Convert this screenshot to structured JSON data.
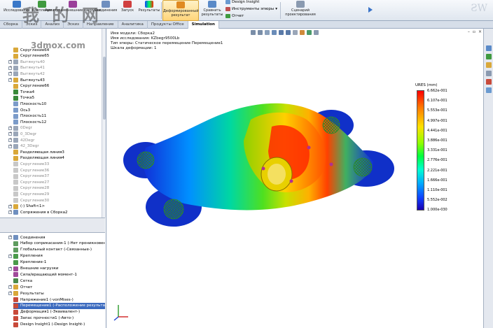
{
  "ribbon": {
    "research_label": "Исследование",
    "fixtures_label": "Крепления",
    "loads_label": "Арматура · Внешние нагрузки",
    "connections_label": "Соединения",
    "run_label": "Запуск",
    "results_label": "Результаты",
    "deformed_label": "Деформированный результат",
    "compare_label": "Сравнить результаты",
    "design_insight_label": "Design Insight",
    "plot_tools_label": "Инструменты эпюры",
    "report_label": "Отчет",
    "scenario_label": "Сценарий проектирования"
  },
  "tabs": [
    {
      "label": "Сборка"
    },
    {
      "label": "Эскиз"
    },
    {
      "label": "Анализ"
    },
    {
      "label": "Эскиз"
    },
    {
      "label": "Направление"
    },
    {
      "label": "Аналитика"
    },
    {
      "label": "Продукты Office"
    },
    {
      "label": "Simulation"
    }
  ],
  "tree_top": [
    {
      "label": "Скругление64",
      "grey": false,
      "exp": false,
      "color": "#d9a83a"
    },
    {
      "label": "Скругление65",
      "grey": false,
      "exp": false,
      "color": "#d9a83a"
    },
    {
      "label": "Вытянуть40",
      "grey": true,
      "exp": true,
      "color": "#9aa6b8"
    },
    {
      "label": "Вытянуть41",
      "grey": true,
      "exp": true,
      "color": "#9aa6b8"
    },
    {
      "label": "Вытянуть42",
      "grey": true,
      "exp": true,
      "color": "#9aa6b8"
    },
    {
      "label": "Вытянуть43",
      "grey": false,
      "exp": true,
      "color": "#d9a83a"
    },
    {
      "label": "Скругление66",
      "grey": false,
      "exp": false,
      "color": "#d9a83a"
    },
    {
      "label": "Точка4",
      "grey": false,
      "exp": false,
      "color": "#3a8a3a"
    },
    {
      "label": "Точка5",
      "grey": false,
      "exp": false,
      "color": "#3a8a3a"
    },
    {
      "label": "Плоскость10",
      "grey": false,
      "exp": false,
      "color": "#7b9bc9"
    },
    {
      "label": "Ось3",
      "grey": false,
      "exp": false,
      "color": "#7b9bc9"
    },
    {
      "label": "Плоскость11",
      "grey": false,
      "exp": false,
      "color": "#7b9bc9"
    },
    {
      "label": "Плоскость12",
      "grey": false,
      "exp": false,
      "color": "#7b9bc9"
    },
    {
      "label": "0Degr",
      "grey": true,
      "exp": true,
      "color": "#9aa6b8"
    },
    {
      "label": "0_3Degr",
      "grey": true,
      "exp": true,
      "color": "#9aa6b8"
    },
    {
      "label": "42Degr",
      "grey": true,
      "exp": true,
      "color": "#9aa6b8"
    },
    {
      "label": "42_3Degr",
      "grey": true,
      "exp": true,
      "color": "#9aa6b8"
    },
    {
      "label": "Разделяющая линия3",
      "grey": false,
      "exp": false,
      "color": "#d9a83a"
    },
    {
      "label": "Разделяющая линия4",
      "grey": false,
      "exp": false,
      "color": "#d9a83a"
    },
    {
      "label": "Скругление33",
      "grey": true,
      "exp": false,
      "color": "#c8c8c8"
    },
    {
      "label": "Скругление36",
      "grey": true,
      "exp": false,
      "color": "#c8c8c8"
    },
    {
      "label": "Скругление37",
      "grey": true,
      "exp": false,
      "color": "#c8c8c8"
    },
    {
      "label": "Скругление27",
      "grey": true,
      "exp": false,
      "color": "#c8c8c8"
    },
    {
      "label": "Скругление28",
      "grey": true,
      "exp": false,
      "color": "#c8c8c8"
    },
    {
      "label": "Скругление29",
      "grey": true,
      "exp": false,
      "color": "#c8c8c8"
    },
    {
      "label": "Скругление30",
      "grey": true,
      "exp": false,
      "color": "#c8c8c8"
    },
    {
      "label": "(-) Shaft<1>",
      "grey": false,
      "exp": true,
      "color": "#d9a83a"
    },
    {
      "label": "Сопряжения в Сборка2",
      "grey": false,
      "exp": true,
      "color": "#6f8fbf"
    }
  ],
  "tree_bottom": [
    {
      "label": "Соединения",
      "grey": false,
      "exp": true,
      "sel": false,
      "color": "#6f8fbf"
    },
    {
      "label": "Набор соприкасания-1 (-Нет проникновения-)",
      "grey": false,
      "exp": false,
      "sel": false,
      "color": "#5e9c5e"
    },
    {
      "label": "Глобальный контакт (-Связанные-)",
      "grey": false,
      "exp": false,
      "sel": false,
      "color": "#5e9c5e"
    },
    {
      "label": "Крепления",
      "grey": false,
      "exp": true,
      "sel": false,
      "color": "#4a9a4a"
    },
    {
      "label": "Крепление-1",
      "grey": false,
      "exp": false,
      "sel": false,
      "color": "#4a9a4a"
    },
    {
      "label": "Внешние нагрузки",
      "grey": false,
      "exp": true,
      "sel": false,
      "color": "#a04a9a"
    },
    {
      "label": "Сила/вращающий момент-1",
      "grey": false,
      "exp": false,
      "sel": false,
      "color": "#a04a9a"
    },
    {
      "label": "Сетка",
      "grey": false,
      "exp": false,
      "sel": false,
      "color": "#4a8a4a"
    },
    {
      "label": "Отчет",
      "grey": false,
      "exp": true,
      "sel": false,
      "color": "#d9a83a"
    },
    {
      "label": "Результаты",
      "grey": false,
      "exp": true,
      "sel": false,
      "color": "#d9a83a"
    },
    {
      "label": "Напряжение1 (-vonMises-)",
      "grey": false,
      "exp": false,
      "sel": false,
      "color": "#c84a3a"
    },
    {
      "label": "Перемещение1 (-Расположение результата-)",
      "grey": false,
      "exp": false,
      "sel": true,
      "color": "#c84a3a"
    },
    {
      "label": "Деформация1 (-Эквивалент-)",
      "grey": false,
      "exp": false,
      "sel": false,
      "color": "#c84a3a"
    },
    {
      "label": "Запас прочности1 (-Авто-)",
      "grey": false,
      "exp": false,
      "sel": false,
      "color": "#c84a3a"
    },
    {
      "label": "Design Insight1 (-Design Insight-)",
      "grey": false,
      "exp": false,
      "sel": false,
      "color": "#c84a3a"
    }
  ],
  "viewport": {
    "model_name": "Имя модели: Сборка2",
    "study_name": "Имя исследования: KZbegr9500Lb",
    "plot_type": "Тип эпюры: Статическое перемещение Перемещение1",
    "scale": "Шкала деформации: 1"
  },
  "legend": {
    "title": "URES (mm)",
    "values": [
      "6.662e-001",
      "6.107e-001",
      "5.553e-001",
      "4.997e-001",
      "4.441e-001",
      "3.886e-001",
      "3.331e-001",
      "2.776e-001",
      "2.221e-001",
      "1.666e-001",
      "1.110e-001",
      "5.552e-002",
      "1.000e-030"
    ]
  },
  "watermark": {
    "text_cn": "我 的 网",
    "url": "3dmox.com"
  }
}
